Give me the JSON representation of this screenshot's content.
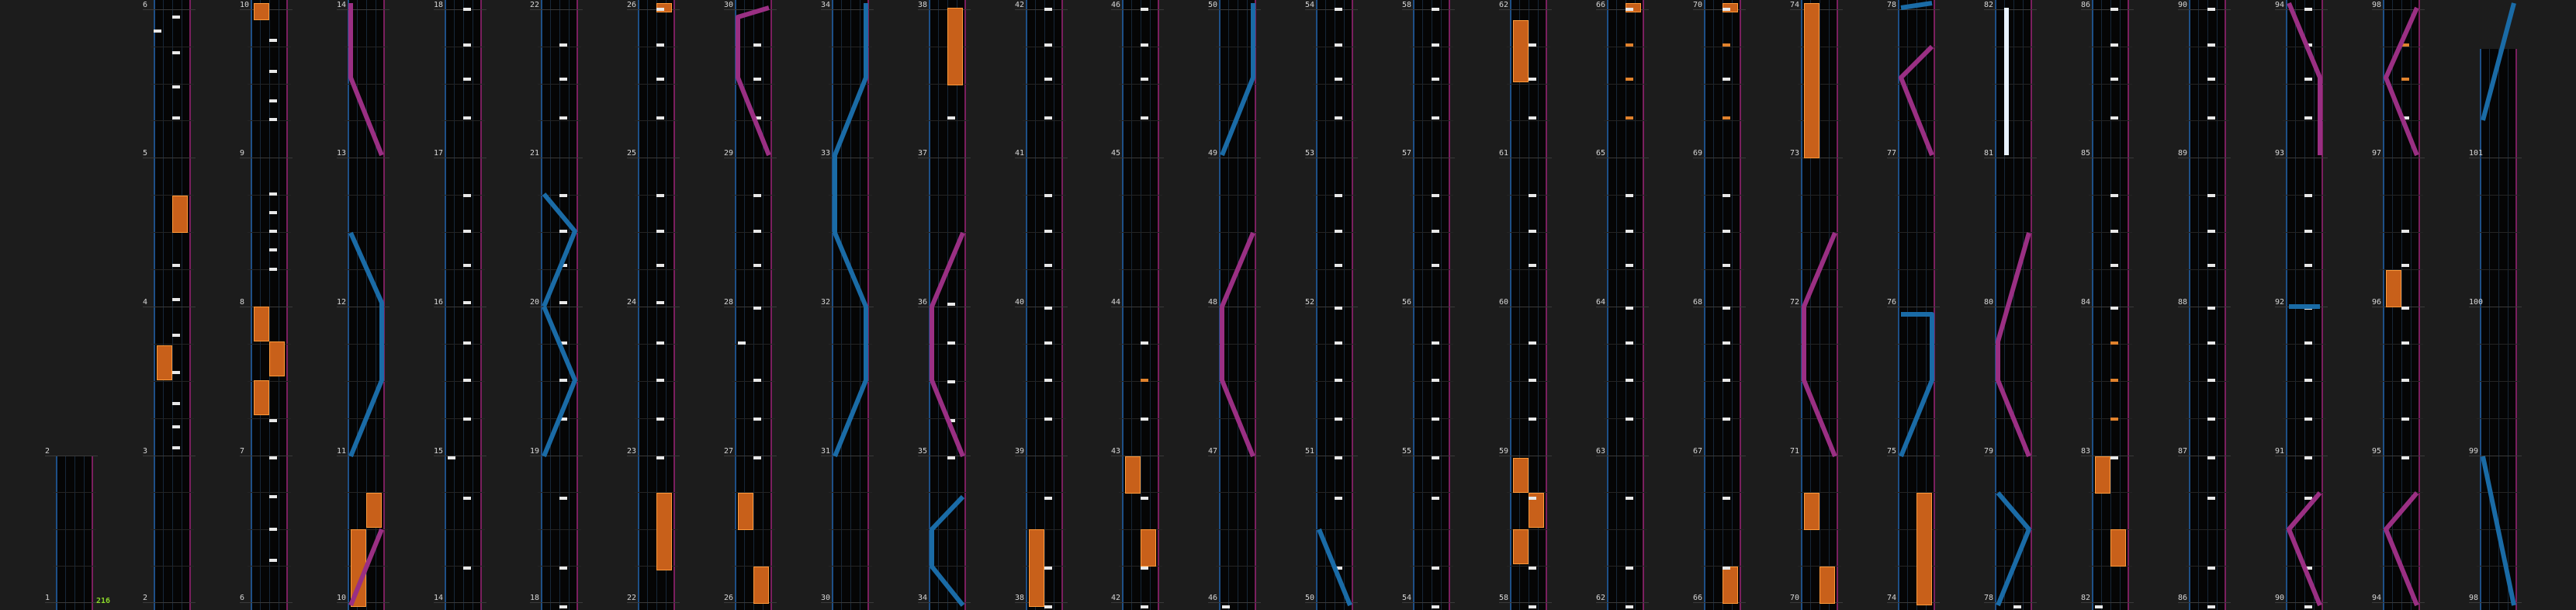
{
  "combo_counter": "216",
  "colors": {
    "tap": "#e8e8e8",
    "flick": "#e0822d",
    "hold": "#c8601a",
    "slide_blue": "#1a6ba6",
    "slide_pink": "#9a2f83",
    "lane_left": "#1e4f86",
    "lane_right": "#7a1f5e"
  },
  "columns": [
    {
      "labels": [
        "1",
        "2"
      ],
      "notes": []
    },
    {
      "labels": [
        "2",
        "3",
        "4",
        "5",
        "6"
      ],
      "notes": []
    },
    {
      "labels": [
        "6",
        "7",
        "8",
        "9",
        "10"
      ],
      "notes": []
    },
    {
      "labels": [
        "10",
        "11",
        "12",
        "13",
        "14"
      ],
      "notes": []
    },
    {
      "labels": [
        "14",
        "15",
        "16",
        "17",
        "18"
      ],
      "notes": []
    },
    {
      "labels": [
        "18",
        "19",
        "20",
        "21",
        "22"
      ],
      "notes": []
    },
    {
      "labels": [
        "22",
        "23",
        "24",
        "25",
        "26"
      ],
      "notes": []
    },
    {
      "labels": [
        "26",
        "27",
        "28",
        "29",
        "30"
      ],
      "notes": []
    },
    {
      "labels": [
        "30",
        "31",
        "32",
        "33",
        "34"
      ],
      "notes": []
    },
    {
      "labels": [
        "34",
        "35",
        "36",
        "37",
        "38"
      ],
      "notes": []
    },
    {
      "labels": [
        "38",
        "39",
        "40",
        "41",
        "42"
      ],
      "notes": []
    },
    {
      "labels": [
        "42",
        "43",
        "44",
        "45",
        "46"
      ],
      "notes": []
    },
    {
      "labels": [
        "46",
        "47",
        "48",
        "49",
        "50"
      ],
      "notes": []
    },
    {
      "labels": [
        "50",
        "51",
        "52",
        "53",
        "54"
      ],
      "notes": []
    },
    {
      "labels": [
        "54",
        "55",
        "56",
        "57",
        "58"
      ],
      "notes": []
    },
    {
      "labels": [
        "58",
        "59",
        "60",
        "61",
        "62"
      ],
      "notes": []
    },
    {
      "labels": [
        "62",
        "63",
        "64",
        "65",
        "66"
      ],
      "notes": []
    },
    {
      "labels": [
        "66",
        "67",
        "68",
        "69",
        "70"
      ],
      "notes": []
    },
    {
      "labels": [
        "70",
        "71",
        "72",
        "73",
        "74"
      ],
      "notes": []
    },
    {
      "labels": [
        "74",
        "75",
        "76",
        "77",
        "78"
      ],
      "notes": []
    },
    {
      "labels": [
        "78",
        "79",
        "80",
        "81",
        "82"
      ],
      "notes": []
    },
    {
      "labels": [
        "82",
        "83",
        "84",
        "85",
        "86"
      ],
      "notes": []
    },
    {
      "labels": [
        "86",
        "87",
        "88",
        "89",
        "90"
      ],
      "notes": []
    },
    {
      "labels": [
        "90",
        "91",
        "92",
        "93",
        "94"
      ],
      "notes": []
    },
    {
      "labels": [
        "94",
        "95",
        "96",
        "97",
        "98"
      ],
      "notes": []
    },
    {
      "labels": [
        "98",
        "99",
        "100",
        "101"
      ],
      "notes": []
    }
  ]
}
